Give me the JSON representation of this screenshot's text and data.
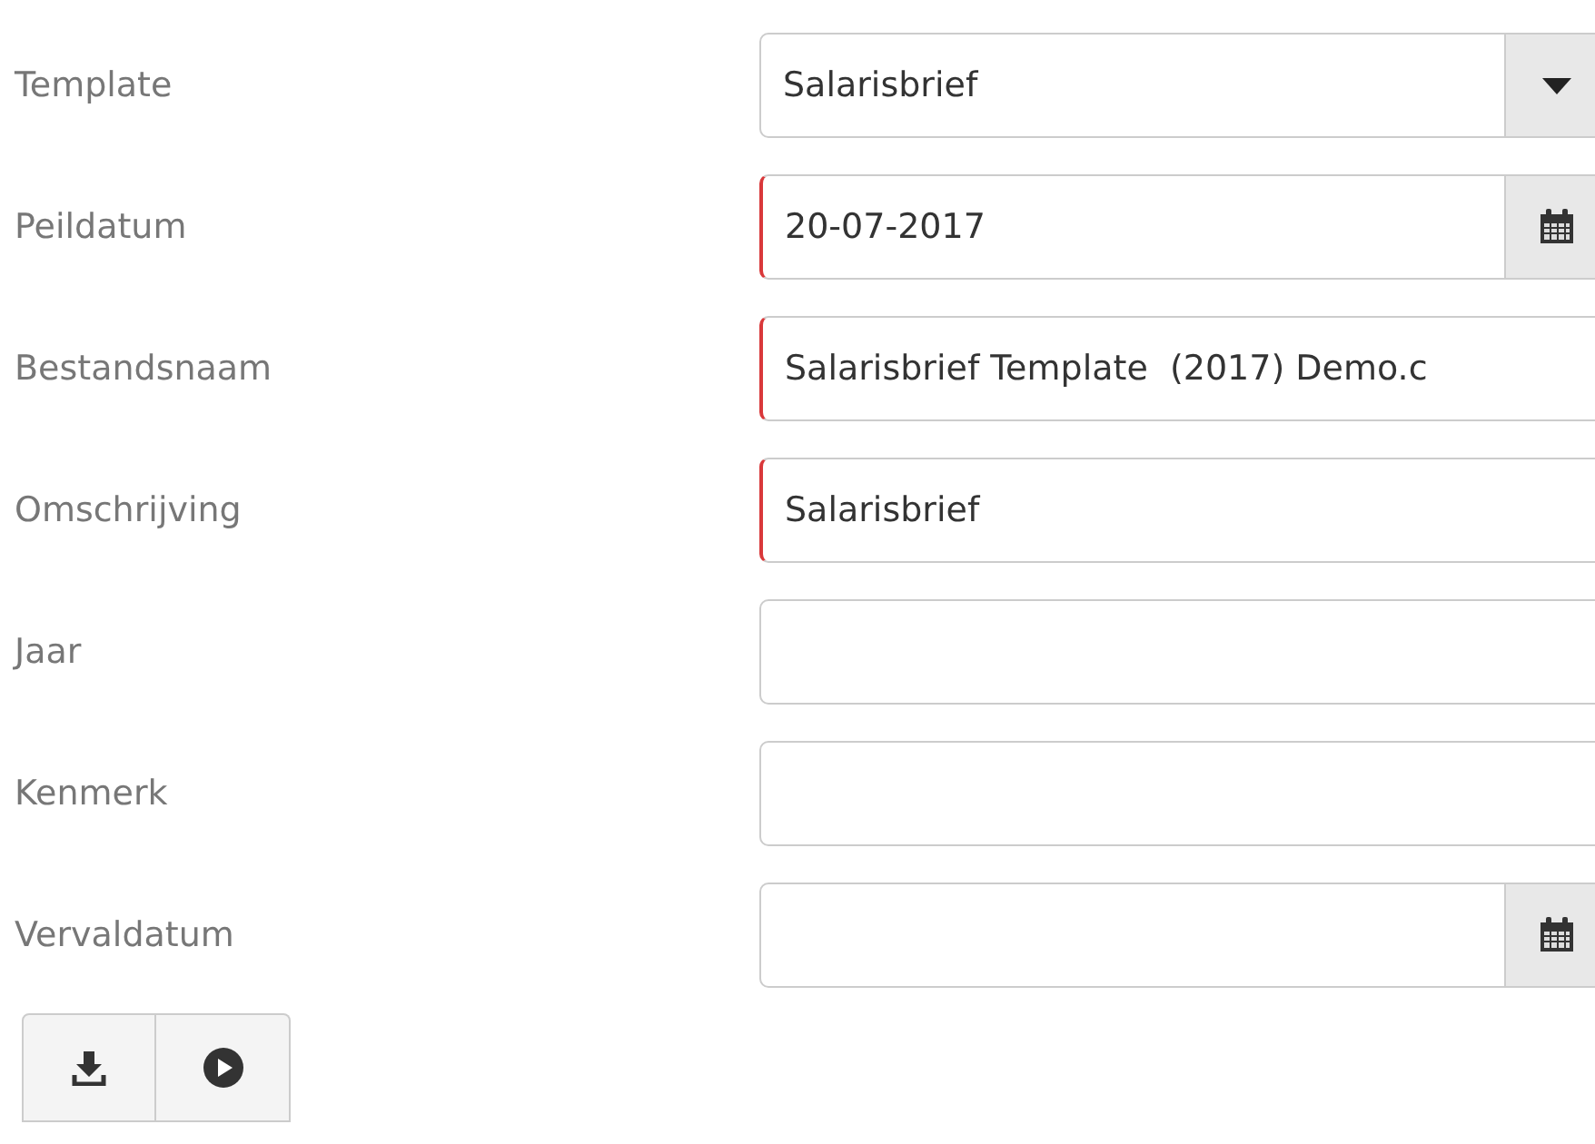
{
  "fields": [
    {
      "label": "Template",
      "kind": "select",
      "value": "Salarisbrief",
      "required": false
    },
    {
      "label": "Peildatum",
      "kind": "date",
      "value": "20-07-2017",
      "required": true
    },
    {
      "label": "Bestandsnaam",
      "kind": "text",
      "value": "Salarisbrief Template  (2017) Demo.c",
      "required": true
    },
    {
      "label": "Omschrijving",
      "kind": "text",
      "value": "Salarisbrief",
      "required": true
    },
    {
      "label": "Jaar",
      "kind": "text",
      "required": false
    },
    {
      "label": "Kenmerk",
      "kind": "text",
      "required": false
    },
    {
      "label": "Vervaldatum",
      "kind": "date",
      "required": false
    }
  ],
  "actions": [
    {
      "kind": "download"
    },
    {
      "kind": "play"
    }
  ]
}
